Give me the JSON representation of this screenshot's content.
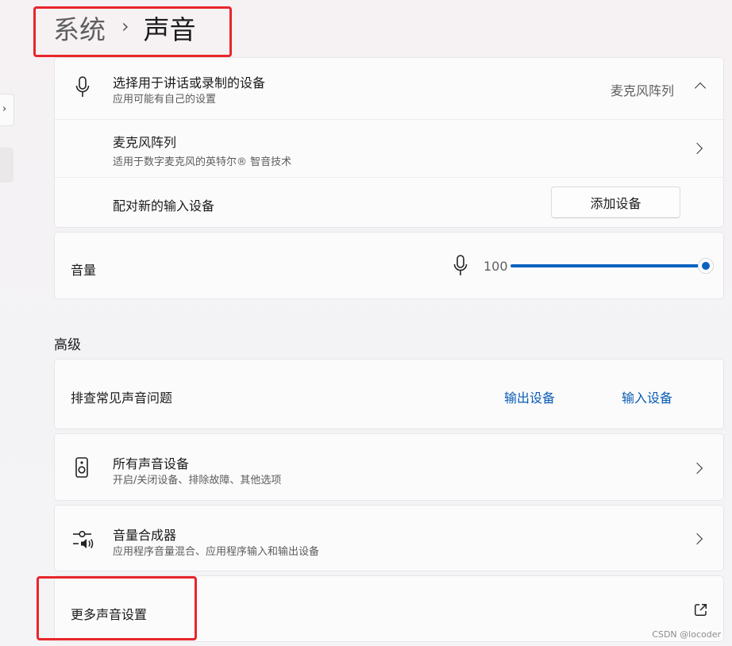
{
  "breadcrumb": {
    "parent": "系统",
    "separator": "›",
    "current": "声音"
  },
  "input_device": {
    "title": "选择用于讲话或录制的设备",
    "subtitle": "应用可能有自己的设置",
    "selected": "麦克风阵列",
    "icon": "microphone-icon",
    "device_row": {
      "title": "麦克风阵列",
      "subtitle": "适用于数字麦克风的英特尔® 智音技术"
    },
    "pair_row": {
      "title": "配对新的输入设备",
      "button": "添加设备"
    }
  },
  "volume": {
    "label": "音量",
    "value": "100",
    "level": 1.0,
    "icon": "microphone-icon",
    "accent": "#0b62c0"
  },
  "advanced": {
    "heading": "高级",
    "troubleshoot": {
      "title": "排查常见声音问题",
      "output_link": "输出设备",
      "input_link": "输入设备"
    },
    "all_devices": {
      "title": "所有声音设备",
      "subtitle": "开启/关闭设备、排除故障、其他选项",
      "icon": "speaker-icon"
    },
    "mixer": {
      "title": "音量合成器",
      "subtitle": "应用程序音量混合、应用程序输入和输出设备",
      "icon": "mixer-icon"
    },
    "more": {
      "title": "更多声音设置",
      "icon": "open-external-icon"
    }
  },
  "watermark": "CSDN @locoder",
  "colors": {
    "highlight_box": "#e8262b",
    "link": "#0a5cb3"
  }
}
